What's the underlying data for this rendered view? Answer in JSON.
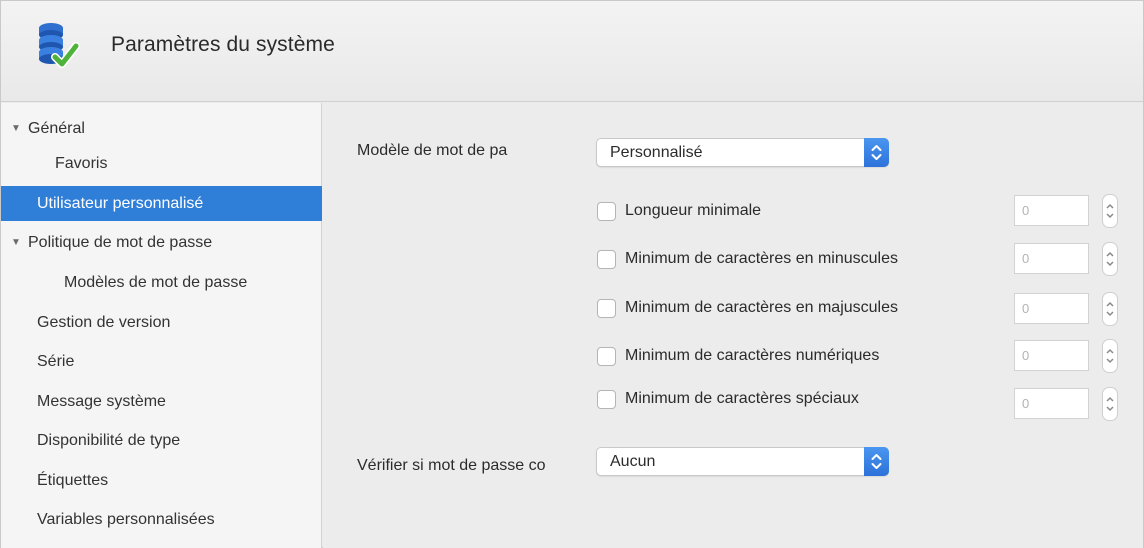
{
  "window": {
    "title": "Paramètres du système"
  },
  "sidebar": {
    "items": [
      {
        "label": "Général",
        "disclosure": "▼"
      },
      {
        "label": "Favoris"
      },
      {
        "label": "Utilisateur personnalisé",
        "selected": true
      },
      {
        "label": "Politique de mot de passe",
        "disclosure": "▼"
      },
      {
        "label": "Modèles de mot de passe"
      },
      {
        "label": "Gestion de version"
      },
      {
        "label": "Série"
      },
      {
        "label": "Message système"
      },
      {
        "label": "Disponibilité de type"
      },
      {
        "label": "Étiquettes"
      },
      {
        "label": "Variables personnalisées"
      }
    ]
  },
  "form": {
    "model_label": "Modèle de mot de pa",
    "model_value": "Personnalisé",
    "rules": [
      {
        "label": "Longueur minimale",
        "checked": false,
        "value": "0"
      },
      {
        "label": "Minimum de caractères en minuscules",
        "checked": false,
        "value": "0"
      },
      {
        "label": "Minimum de caractères en majuscules",
        "checked": false,
        "value": "0"
      },
      {
        "label": "Minimum de caractères numériques",
        "checked": false,
        "value": "0"
      },
      {
        "label": "Minimum de caractères spéciaux",
        "checked": false,
        "value": "0"
      }
    ],
    "verify_label": "Vérifier si mot de passe co",
    "verify_value": "Aucun"
  },
  "colors": {
    "selection": "#2f7ed8",
    "popup_button": "#3b84e6",
    "window_bg": "#ececec"
  },
  "icons": {
    "app": "database-check-icon",
    "popup": "chevron-updown-icon",
    "stepper": "stepper-icon",
    "disclosure": "disclosure-triangle-icon"
  }
}
